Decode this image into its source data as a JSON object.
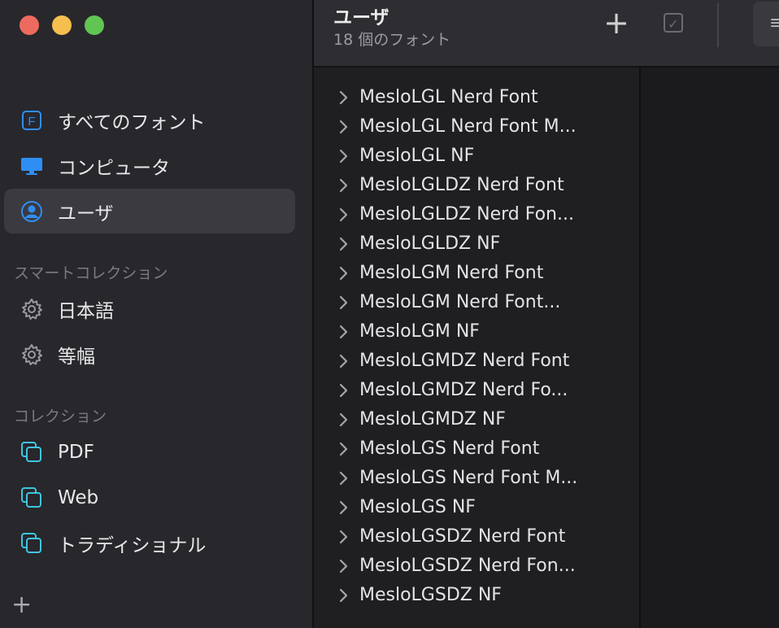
{
  "sidebar": {
    "items": [
      {
        "label": "すべてのフォント",
        "icon": "font-book-icon"
      },
      {
        "label": "コンピュータ",
        "icon": "computer-icon"
      },
      {
        "label": "ユーザ",
        "icon": "user-icon"
      }
    ],
    "smart_section": "スマートコレクション",
    "smart_items": [
      {
        "label": "日本語",
        "icon": "gear-icon"
      },
      {
        "label": "等幅",
        "icon": "gear-icon"
      }
    ],
    "collection_section": "コレクション",
    "collection_items": [
      {
        "label": "PDF",
        "icon": "collection-icon"
      },
      {
        "label": "Web",
        "icon": "collection-icon"
      },
      {
        "label": "トラディショナル",
        "icon": "collection-icon"
      }
    ],
    "add_label": "+"
  },
  "toolbar": {
    "title": "ユーザ",
    "subtitle": "18 個のフォント",
    "add_label": "+",
    "check_label": "✓"
  },
  "fonts": [
    "MesloLGL Nerd Font",
    "MesloLGL Nerd Font M...",
    "MesloLGL NF",
    "MesloLGLDZ Nerd Font",
    "MesloLGLDZ Nerd Fon...",
    "MesloLGLDZ NF",
    "MesloLGM Nerd Font",
    "MesloLGM Nerd Font...",
    "MesloLGM NF",
    "MesloLGMDZ Nerd Font",
    "MesloLGMDZ Nerd Fo...",
    "MesloLGMDZ NF",
    "MesloLGS Nerd Font",
    "MesloLGS Nerd Font M...",
    "MesloLGS NF",
    "MesloLGSDZ Nerd Font",
    "MesloLGSDZ Nerd Fon...",
    "MesloLGSDZ NF"
  ],
  "colors": {
    "accent": "#2f8ef4",
    "collection": "#3ec6e0",
    "sidebar_bg": "#28272c",
    "selected_bg": "#3b3a40"
  }
}
